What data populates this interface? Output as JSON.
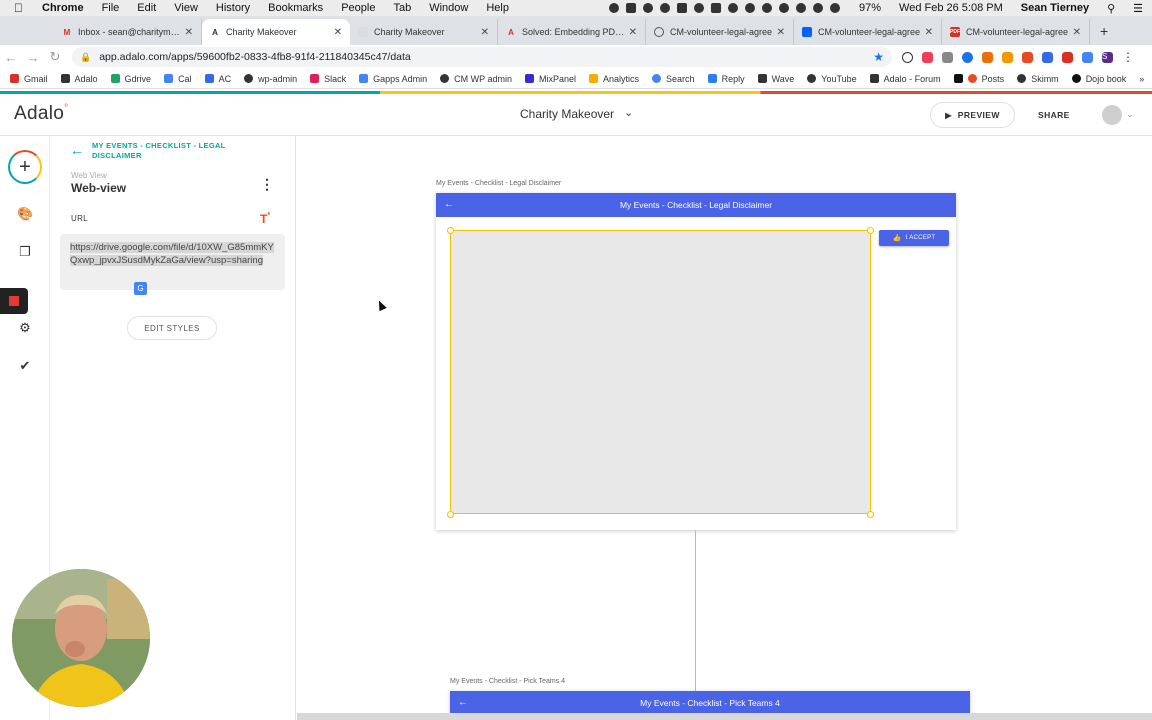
{
  "menubar": {
    "app": "Chrome",
    "items": [
      "File",
      "Edit",
      "View",
      "History",
      "Bookmarks",
      "People",
      "Tab",
      "Window",
      "Help"
    ],
    "battery": "97%",
    "datetime": "Wed Feb 26  5:08 PM",
    "user": "Sean Tierney"
  },
  "tabs": [
    {
      "title": "Inbox - sean@charitymake",
      "favicon": "gmail-icon",
      "color": "#d93025"
    },
    {
      "title": "Charity Makeover",
      "favicon": "adalo-icon",
      "color": "#333333",
      "active": true
    },
    {
      "title": "Charity Makeover",
      "favicon": "page-icon",
      "color": "#9aa0a6"
    },
    {
      "title": "Solved: Embedding PDF Fi",
      "favicon": "adobe-icon",
      "color": "#d93025"
    },
    {
      "title": "CM-volunteer-legal-agree",
      "favicon": "globe-icon",
      "color": "#333333"
    },
    {
      "title": "CM-volunteer-legal-agree",
      "favicon": "dropbox-icon",
      "color": "#0061ff"
    },
    {
      "title": "CM-volunteer-legal-agree",
      "favicon": "pdf-icon",
      "color": "#d93025"
    }
  ],
  "address": {
    "url": "app.adalo.com/apps/59600fb2-0833-4fb8-91f4-211840345c47/data"
  },
  "bookmarks": [
    {
      "label": "Gmail",
      "color": "#d93025"
    },
    {
      "label": "Adalo",
      "color": "#333333"
    },
    {
      "label": "Gdrive",
      "color": "#1fa463"
    },
    {
      "label": "Cal",
      "color": "#4285f4"
    },
    {
      "label": "AC",
      "color": "#356ae6"
    },
    {
      "label": "wp-admin",
      "color": "#333333"
    },
    {
      "label": "Slack",
      "color": "#e01e5a"
    },
    {
      "label": "Gapps Admin",
      "color": "#4285f4"
    },
    {
      "label": "CM WP admin",
      "color": "#333333"
    },
    {
      "label": "MixPanel",
      "color": "#3a2bd0"
    },
    {
      "label": "Analytics",
      "color": "#f9ab00"
    },
    {
      "label": "Search",
      "color": "#4285f4"
    },
    {
      "label": "Reply",
      "color": "#2a7ef0"
    },
    {
      "label": "Wave",
      "color": "#333333"
    },
    {
      "label": "YouTube",
      "color": "#333333"
    },
    {
      "label": "Adalo - Forum",
      "color": "#333333"
    },
    {
      "label": "Posts",
      "color": "#e84a27"
    },
    {
      "label": "Skimm",
      "color": "#333333"
    },
    {
      "label": "Dojo book",
      "color": "#333333"
    }
  ],
  "header": {
    "logo": "Adalo",
    "app_name": "Charity Makeover",
    "preview_label": "PREVIEW",
    "share_label": "SHARE"
  },
  "panel": {
    "breadcrumb": "MY EVENTS - CHECKLIST - LEGAL DISCLAIMER",
    "component_type": "Web View",
    "component_name": "Web-view",
    "url_label": "URL",
    "url_value": "https://drive.google.com/file/d/10XW_G85mmKYQxwp_jpvxJSusdMykZaGa/view?usp=sharing",
    "edit_styles_label": "EDIT STYLES"
  },
  "canvas": {
    "screen1": {
      "label": "My Events - Checklist - Legal Disclaimer",
      "title": "My Events - Checklist - Legal Disclaimer",
      "accept_label": "I ACCEPT"
    },
    "screen2": {
      "label": "My Events - Checklist - Pick Teams 4",
      "title": "My Events - Checklist - Pick Teams 4"
    }
  },
  "colors": {
    "accent_teal": "#00a89d",
    "appbar_blue": "#4a63e7",
    "selection_yellow": "#f2c200"
  }
}
